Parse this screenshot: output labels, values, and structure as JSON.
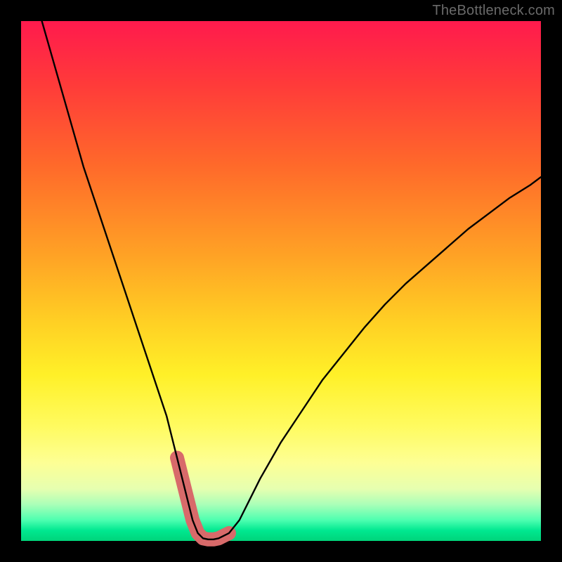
{
  "watermark": "TheBottleneck.com",
  "chart_data": {
    "type": "line",
    "title": "",
    "xlabel": "",
    "ylabel": "",
    "xlim": [
      0,
      100
    ],
    "ylim": [
      0,
      100
    ],
    "series": [
      {
        "name": "bottleneck-curve",
        "x": [
          4,
          6,
          8,
          10,
          12,
          14,
          16,
          18,
          20,
          22,
          24,
          26,
          28,
          30,
          31,
          32,
          33,
          34,
          35,
          36,
          37,
          38,
          40,
          42,
          44,
          46,
          50,
          54,
          58,
          62,
          66,
          70,
          74,
          78,
          82,
          86,
          90,
          94,
          98,
          100
        ],
        "y": [
          100,
          93,
          86,
          79,
          72,
          66,
          60,
          54,
          48,
          42,
          36,
          30,
          24,
          16,
          12,
          8,
          4,
          1.5,
          0.5,
          0.3,
          0.3,
          0.5,
          1.5,
          4,
          8,
          12,
          19,
          25,
          31,
          36,
          41,
          45.5,
          49.5,
          53,
          56.5,
          60,
          63,
          66,
          68.5,
          70
        ]
      }
    ],
    "highlight_segment": {
      "name": "highlight",
      "x": [
        30,
        31,
        32,
        33,
        34,
        35,
        36,
        37,
        38,
        39,
        40
      ],
      "y": [
        16,
        12,
        8,
        4,
        1.5,
        0.5,
        0.3,
        0.3,
        0.5,
        1,
        1.5
      ]
    },
    "background_gradient": {
      "top": "#ff1a4d",
      "upper_mid": "#ff9a25",
      "mid": "#fff028",
      "lower_mid": "#fdff95",
      "bottom": "#00d47a"
    }
  }
}
